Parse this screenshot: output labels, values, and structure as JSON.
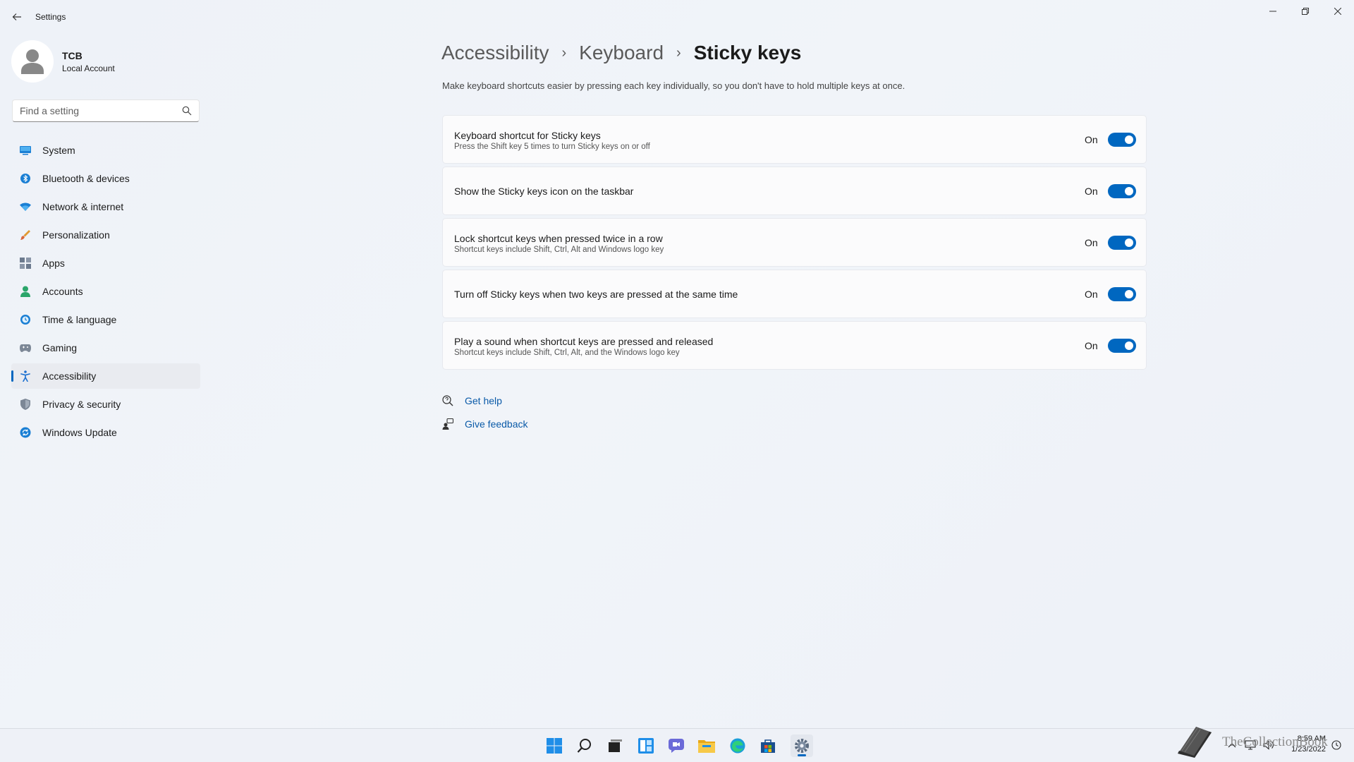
{
  "window": {
    "title": "Settings"
  },
  "profile": {
    "name": "TCB",
    "account_type": "Local Account"
  },
  "search": {
    "placeholder": "Find a setting"
  },
  "sidebar": {
    "items": [
      {
        "label": "System",
        "icon": "monitor-icon"
      },
      {
        "label": "Bluetooth & devices",
        "icon": "bluetooth-icon"
      },
      {
        "label": "Network & internet",
        "icon": "wifi-icon"
      },
      {
        "label": "Personalization",
        "icon": "brush-icon"
      },
      {
        "label": "Apps",
        "icon": "apps-icon"
      },
      {
        "label": "Accounts",
        "icon": "person-icon"
      },
      {
        "label": "Time & language",
        "icon": "globe-clock-icon"
      },
      {
        "label": "Gaming",
        "icon": "gamepad-icon"
      },
      {
        "label": "Accessibility",
        "icon": "accessibility-icon",
        "active": true
      },
      {
        "label": "Privacy & security",
        "icon": "shield-icon"
      },
      {
        "label": "Windows Update",
        "icon": "update-icon"
      }
    ]
  },
  "breadcrumb": {
    "items": [
      "Accessibility",
      "Keyboard",
      "Sticky keys"
    ],
    "separator": "›"
  },
  "description": "Make keyboard shortcuts easier by pressing each key individually, so you don't have to hold multiple keys at once.",
  "settings": [
    {
      "title": "Keyboard shortcut for Sticky keys",
      "subtitle": "Press the Shift key 5 times to turn Sticky keys on or off",
      "state": "On",
      "enabled": true
    },
    {
      "title": "Show the Sticky keys icon on the taskbar",
      "subtitle": "",
      "state": "On",
      "enabled": true
    },
    {
      "title": "Lock shortcut keys when pressed twice in a row",
      "subtitle": "Shortcut keys include Shift, Ctrl, Alt and Windows logo key",
      "state": "On",
      "enabled": true
    },
    {
      "title": "Turn off Sticky keys when two keys are pressed at the same time",
      "subtitle": "",
      "state": "On",
      "enabled": true
    },
    {
      "title": "Play a sound when shortcut keys are pressed and released",
      "subtitle": "Shortcut keys include Shift, Ctrl, Alt, and the Windows logo key",
      "state": "On",
      "enabled": true
    }
  ],
  "help_links": {
    "get_help": "Get help",
    "give_feedback": "Give feedback"
  },
  "taskbar": {
    "apps": [
      "start-icon",
      "search-icon",
      "task-view-icon",
      "widgets-icon",
      "chat-icon",
      "file-explorer-icon",
      "edge-icon",
      "store-icon",
      "settings-icon"
    ],
    "active_app": "settings-icon",
    "time": "8:59 AM",
    "date": "1/23/2022"
  },
  "watermark": {
    "text": "TheCollectionBook"
  },
  "colors": {
    "accent": "#0067c0",
    "link": "#0a5aa8",
    "background": "#eef2f8"
  }
}
